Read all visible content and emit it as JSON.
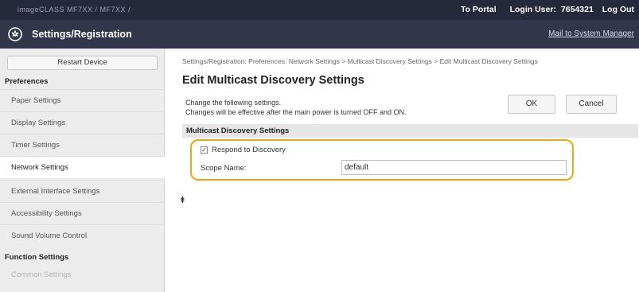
{
  "topbar": {
    "device_name": "imageCLASS    MF7XX / MF7XX /",
    "to_portal": "To Portal",
    "login_user_label": "Login User:",
    "login_user_value": "7654321",
    "logout": "Log Out"
  },
  "header": {
    "title": "Settings/Registration",
    "mail_link": "Mail to System Manager",
    "logo_icon": "settings-logo-icon"
  },
  "sidebar": {
    "restart_button": "Restart Device",
    "preferences_heading": "Preferences",
    "items": [
      {
        "label": "Paper Settings"
      },
      {
        "label": "Display Settings"
      },
      {
        "label": "Timer Settings"
      },
      {
        "label": "Network Settings"
      },
      {
        "label": "External Interface Settings"
      },
      {
        "label": "Accessibility Settings"
      },
      {
        "label": "Sound Volume Control"
      }
    ],
    "function_heading": "Function Settings",
    "dim_item": "Common Settings"
  },
  "main": {
    "breadcrumb": "Settings/Registration: Preferences: Network Settings > Multicast Discovery Settings > Edit Multicast Discovery Settings",
    "title": "Edit Multicast Discovery Settings",
    "description_line1": "Change the following settings.",
    "description_line2": "Changes will be effective after the main power is turned OFF and ON.",
    "ok_button": "OK",
    "cancel_button": "Cancel",
    "section_heading": "Multicast Discovery Settings",
    "respond_label": "Respond to Discovery",
    "respond_checked": "✓",
    "scope_label": "Scope Name:",
    "scope_value": "default",
    "top_icon": "⯒",
    "highlight_color": "#f2a514"
  }
}
